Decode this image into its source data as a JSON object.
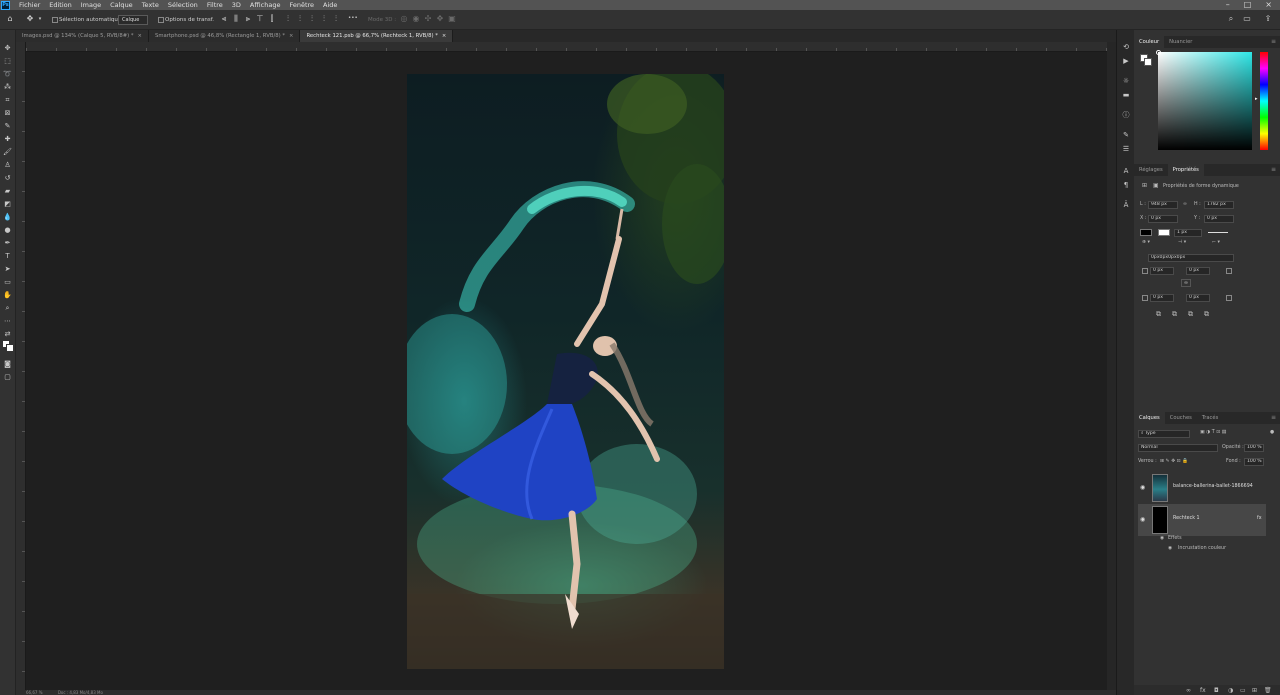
{
  "menubar": {
    "logo": "Ps",
    "items": [
      "Fichier",
      "Edition",
      "Image",
      "Calque",
      "Texte",
      "Sélection",
      "Filtre",
      "3D",
      "Affichage",
      "Fenêtre",
      "Aide"
    ],
    "window_controls": [
      "–",
      "□",
      "×"
    ]
  },
  "options": {
    "auto_select_label": "Sélection automatique :",
    "auto_select_value": "Calque",
    "transform_label": "Options de transf.",
    "mode3d_label": "Mode 3D :",
    "more": "•••"
  },
  "tabs": [
    {
      "label": "Images.psd @ 134% (Calque 5, RVB/8#) *",
      "active": false
    },
    {
      "label": "Smartphone.psd @ 46,8% (Rectangle 1, RVB/8) *",
      "active": false
    },
    {
      "label": "Rechteck 121.psb @ 66,7% (Rechteck 1, RVB/8) *",
      "active": true
    }
  ],
  "color_panel": {
    "tabs": [
      "Couleur",
      "Nuancier"
    ],
    "hue_color": "#2ee6e6"
  },
  "properties_panel": {
    "tabs": [
      "Réglages",
      "Propriétés"
    ],
    "title": "Propriétés de forme dynamique",
    "w_label": "L :",
    "w_value": "948 px",
    "h_label": "H :",
    "h_value": "1782 px",
    "x_label": "X :",
    "x_value": "0 px",
    "y_label": "Y :",
    "y_value": "0 px",
    "stroke_value": "1 px",
    "radius_text": "0px0px0px0px",
    "corner_values": [
      "0 px",
      "0 px",
      "0 px",
      "0 px"
    ],
    "link_icon": "∞"
  },
  "layers_panel": {
    "tabs": [
      "Calques",
      "Couches",
      "Tracés"
    ],
    "filter_label": "Type",
    "blend_mode": "Normal",
    "opacity_label": "Opacité :",
    "opacity_value": "100 %",
    "lock_label": "Verrou :",
    "fill_label": "Fond :",
    "fill_value": "100 %",
    "layers": [
      {
        "name": "balance-ballerina-ballet-1866694"
      },
      {
        "name": "Rechteck 1",
        "fx": "fx"
      }
    ],
    "effects_label": "Effets",
    "effect_item": "Incrustation couleur"
  },
  "status": {
    "zoom": "66,67 %",
    "doc": "Doc : 4,83 Mo/4,83 Mo"
  }
}
